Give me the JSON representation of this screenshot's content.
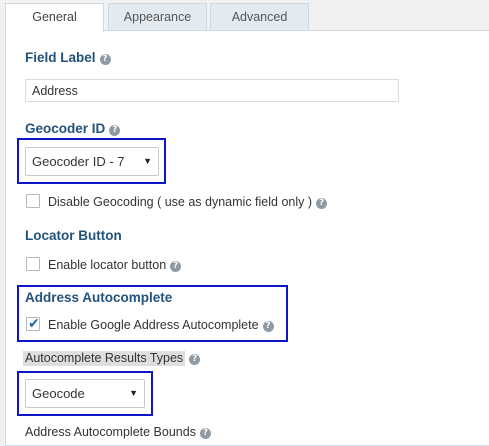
{
  "tabs": [
    {
      "label": "General",
      "active": true
    },
    {
      "label": "Appearance",
      "active": false
    },
    {
      "label": "Advanced",
      "active": false
    }
  ],
  "field_label": {
    "label": "Field Label",
    "value": "Address"
  },
  "geocoder_id": {
    "label": "Geocoder ID",
    "selected": "Geocoder ID - 7"
  },
  "disable_geocoding": {
    "label": "Disable Geocoding ( use as dynamic field only )",
    "checked": false
  },
  "locator_button": {
    "heading": "Locator Button",
    "option_label": "Enable locator button",
    "checked": false
  },
  "address_autocomplete": {
    "heading": "Address Autocomplete",
    "option_label": "Enable Google Address Autocomplete",
    "checked": true
  },
  "autocomplete_results_types": {
    "label": "Autocomplete Results Types",
    "selected": "Geocode"
  },
  "autocomplete_bounds": {
    "label": "Address Autocomplete Bounds"
  },
  "help_glyph": "?",
  "check_glyph": "✔",
  "dropdown_glyph": "▼",
  "colors": {
    "highlight_border": "#0d16c7",
    "label_blue": "#23527c",
    "checkbox_tick": "#1e6ba8"
  }
}
